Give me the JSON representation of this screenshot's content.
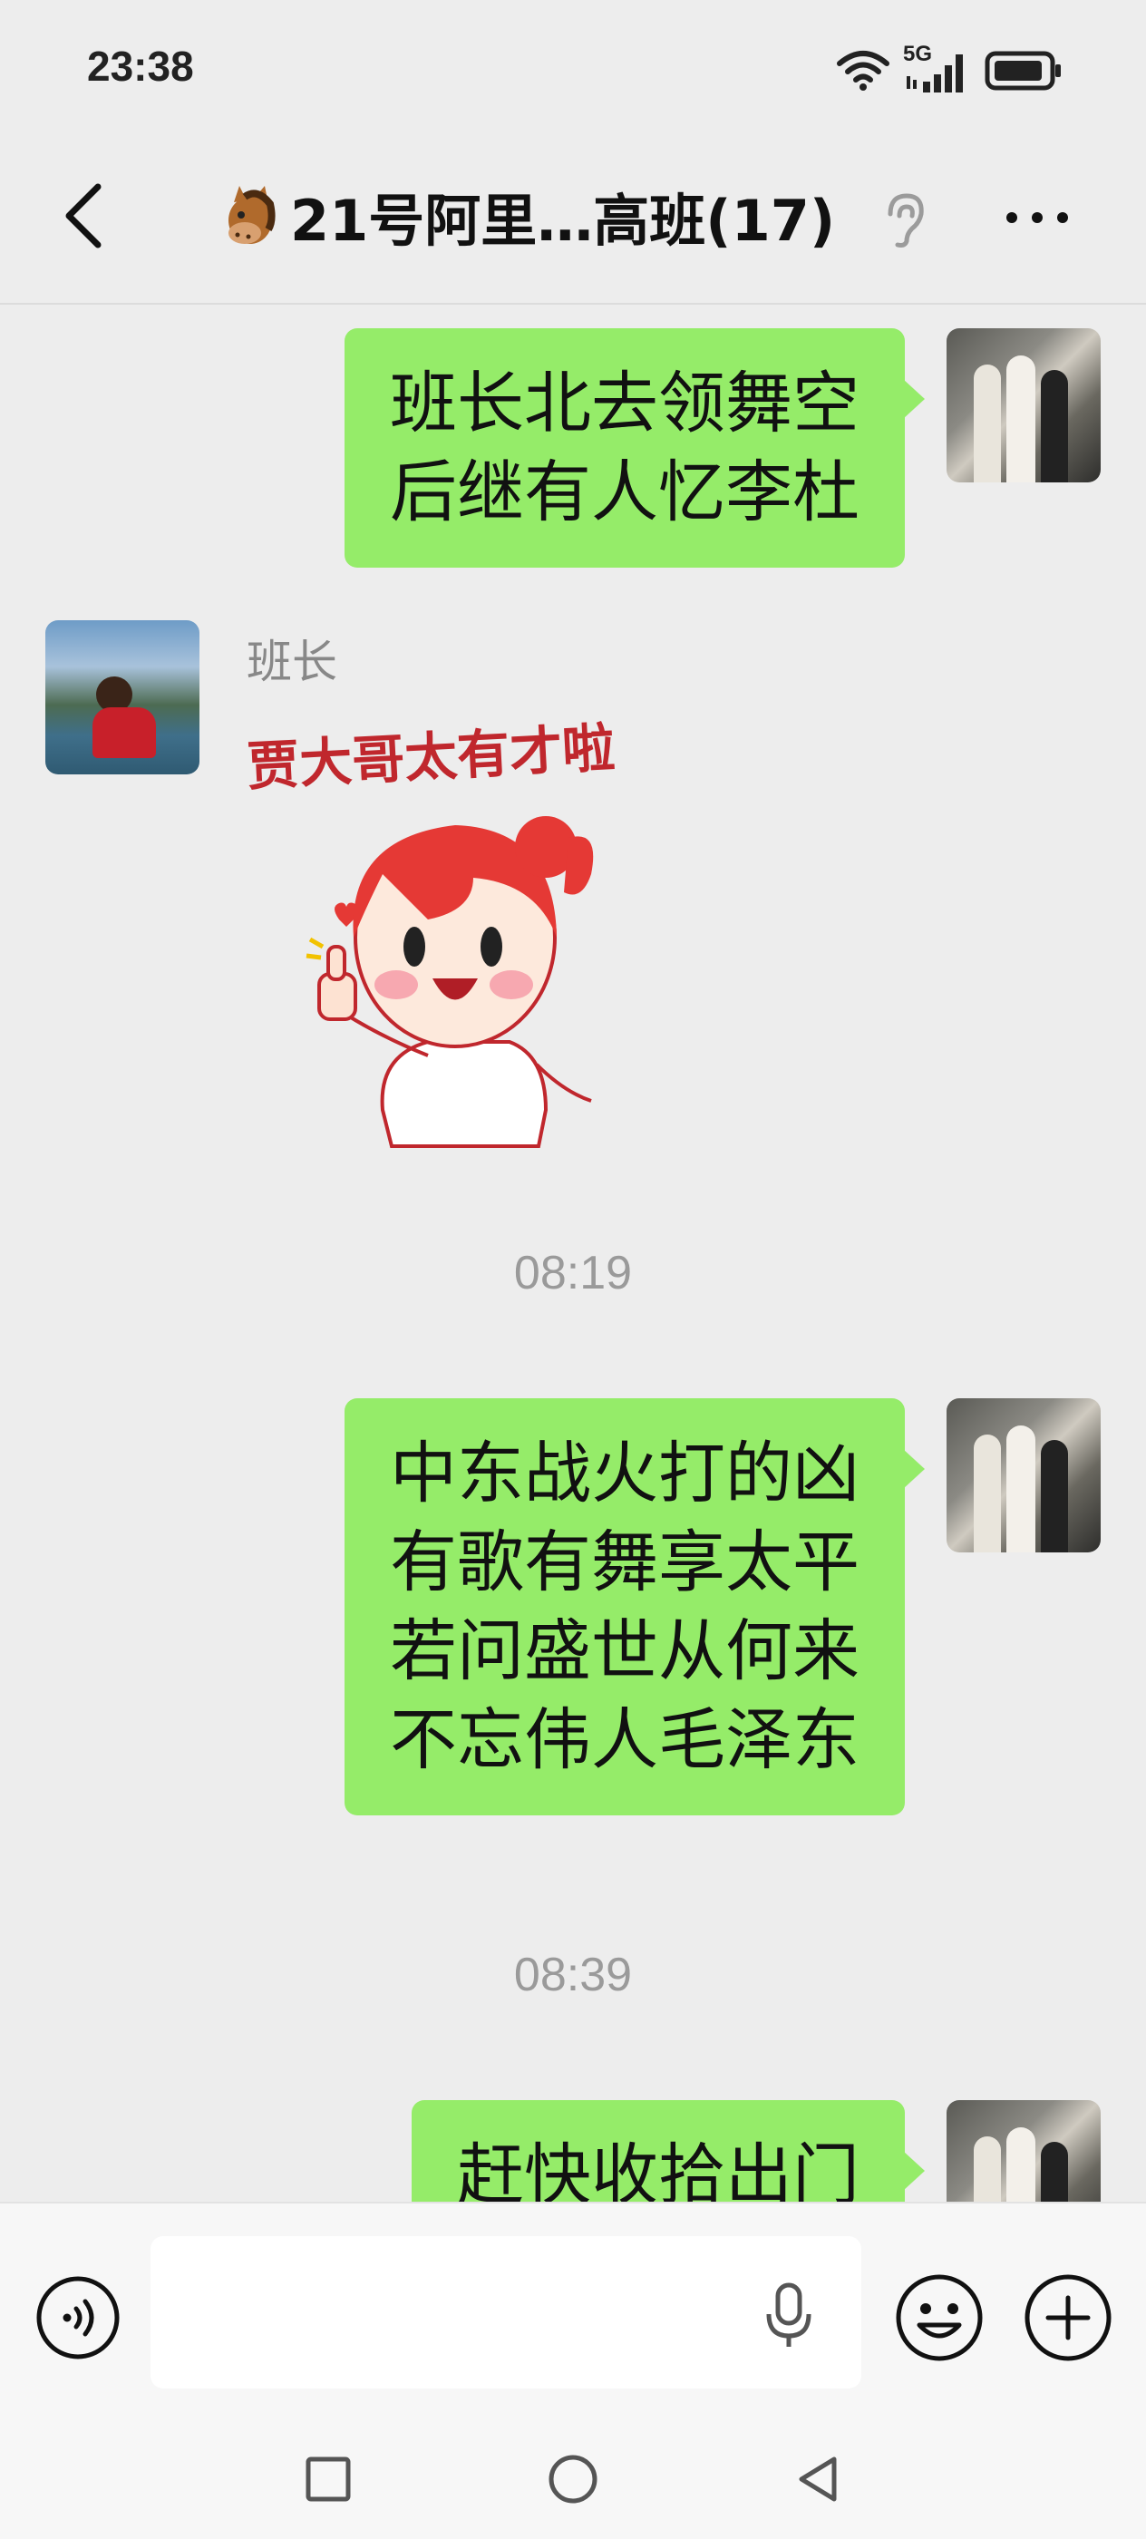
{
  "status_bar": {
    "time": "23:38",
    "network_label": "5G",
    "icons": [
      "wifi-icon",
      "signal-icon",
      "battery-icon"
    ]
  },
  "header": {
    "title_emoji": "horse-face-icon",
    "title": "21号阿里…高班(17)",
    "back_icon": "back-chevron-icon",
    "ear_icon": "earpiece-mode-icon",
    "more_icon": "more-dots-icon"
  },
  "messages": [
    {
      "type": "text",
      "side": "right",
      "lines": [
        "班长北去领舞空",
        "后继有人忆李杜"
      ]
    },
    {
      "type": "sticker",
      "side": "left",
      "sender": "班长",
      "caption": "贾大哥太有才啦"
    },
    {
      "type": "time",
      "text": "08:19"
    },
    {
      "type": "text",
      "side": "right",
      "lines": [
        "中东战火打的凶",
        "有歌有舞享太平",
        "若问盛世从何来",
        "不忘伟人毛泽东"
      ]
    },
    {
      "type": "time",
      "text": "08:39"
    },
    {
      "type": "text",
      "side": "right",
      "lines": [
        "赶快收拾出门"
      ]
    }
  ],
  "input_bar": {
    "value": "",
    "placeholder": "",
    "icons": [
      "voice-icon",
      "mic-icon",
      "emoji-icon",
      "plus-icon"
    ]
  },
  "system_nav": [
    "recent-apps-icon",
    "home-icon",
    "back-triangle-icon"
  ],
  "colors": {
    "background": "#ededed",
    "bubble_green": "#95ec69",
    "sticker_caption_red": "#c0272d"
  }
}
